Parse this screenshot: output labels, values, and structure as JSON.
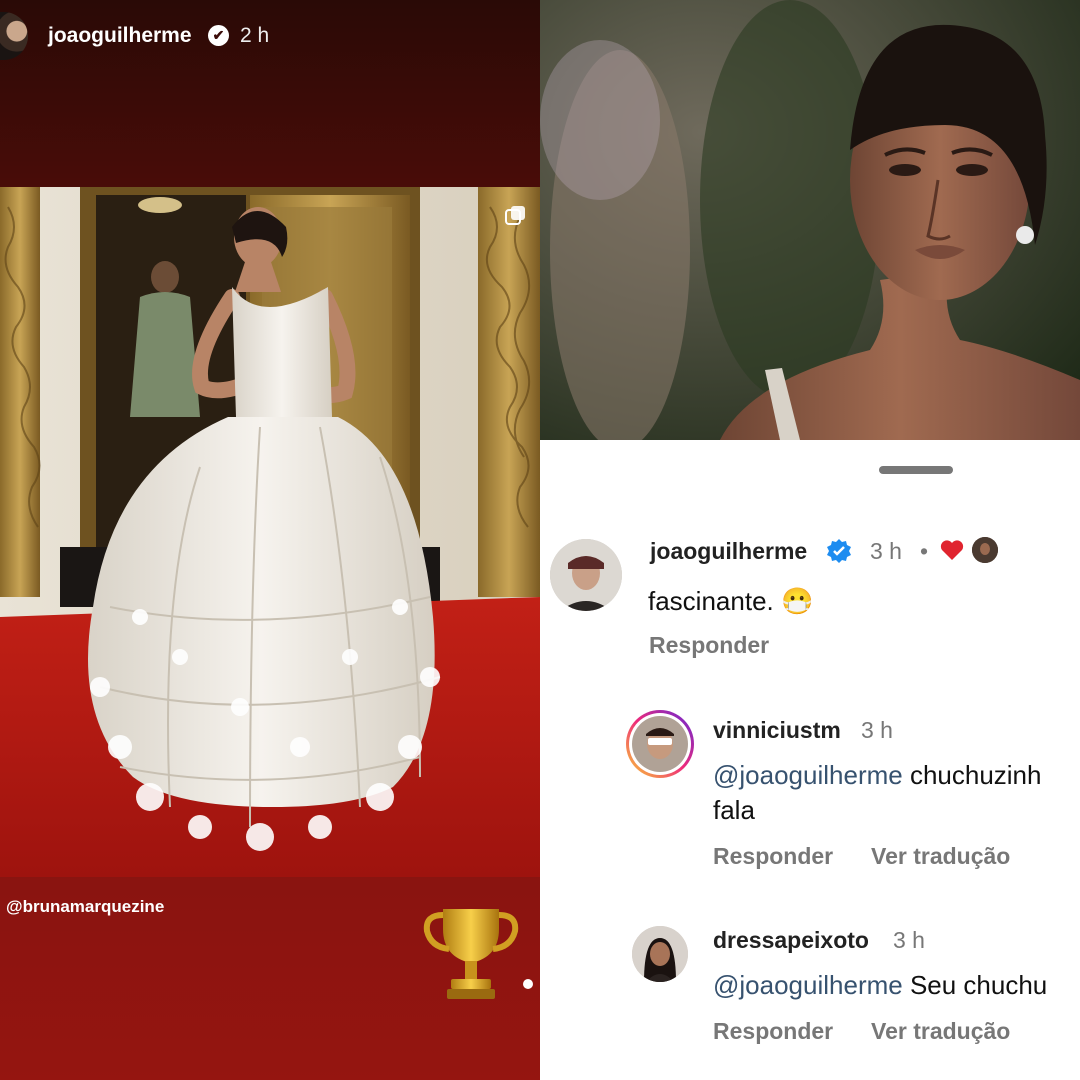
{
  "story": {
    "username": "joaoguilherme",
    "verified_mark": "✔",
    "time": "2 h",
    "mention_tag": "@brunamarquezine",
    "sticker": "trophy-icon"
  },
  "comments": [
    {
      "username": "joaoguilherme",
      "time": "3 h",
      "separator": "•",
      "text": "fascinante.",
      "emoji": "😷",
      "reply_label": "Responder",
      "liked": "heart-icon"
    },
    {
      "username": "vinniciustm",
      "time": "3 h",
      "mention": "@joaoguilherme",
      "text_line1": " chuchuzinh",
      "text_line2": "fala",
      "reply_label": "Responder",
      "translate_label": "Ver tradução"
    },
    {
      "username": "dressapeixoto",
      "time": "3 h",
      "mention": "@joaoguilherme",
      "text_line1": " Seu chuchu",
      "reply_label": "Responder",
      "translate_label": "Ver tradução"
    }
  ],
  "colors": {
    "story_bg": "#6a0e0a",
    "verified_blue": "#1d8cf0",
    "mention": "#37526f",
    "muted": "#777777",
    "heart": "#e0242f"
  }
}
